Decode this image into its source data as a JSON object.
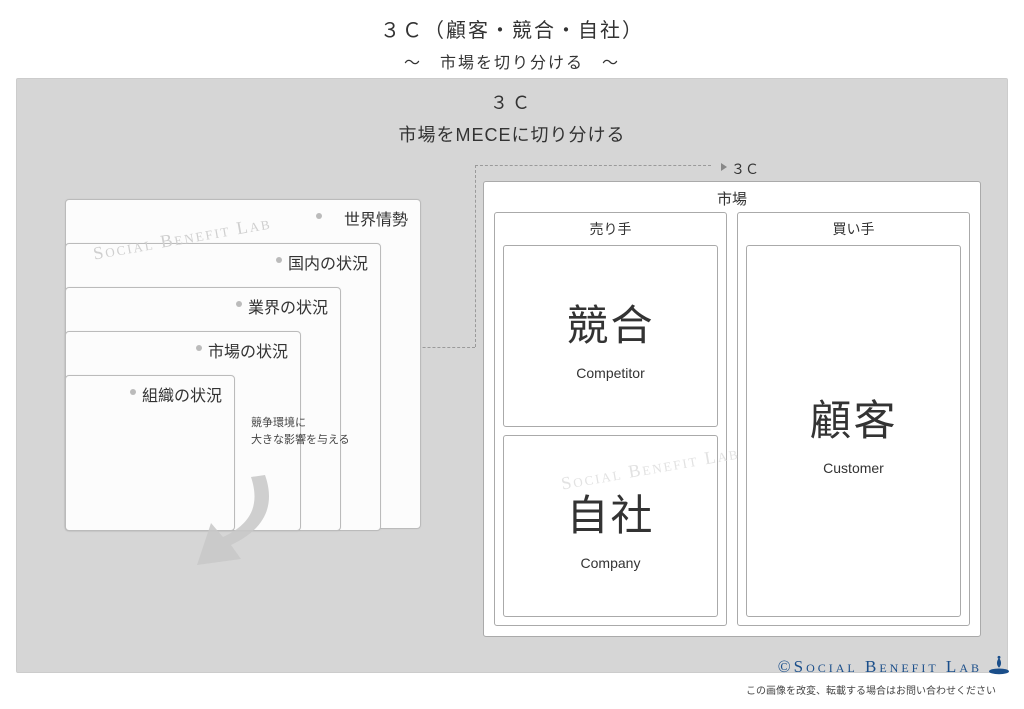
{
  "title": "３Ｃ（顧客・競合・自社）",
  "subtitle": "〜　市場を切り分ける　〜",
  "canvas": {
    "heading": "３Ｃ",
    "subheading": "市場をMECEに切り分ける"
  },
  "stack": {
    "boxes": [
      "世界情勢",
      "国内の状況",
      "業界の状況",
      "市場の状況",
      "組織の状況"
    ],
    "note_line1": "競争環境に",
    "note_line2": "大きな影響を与える"
  },
  "framework": {
    "pointer_label": "３Ｃ",
    "market_label": "市場",
    "seller_label": "売り手",
    "buyer_label": "買い手",
    "competitor_jp": "競合",
    "competitor_en": "Competitor",
    "company_jp": "自社",
    "company_en": "Company",
    "customer_jp": "顧客",
    "customer_en": "Customer"
  },
  "watermark": "Social Benefit Lab",
  "footer": {
    "brand": "©Social Benefit Lab",
    "note": "この画像を改変、転載する場合はお問い合わせください"
  }
}
